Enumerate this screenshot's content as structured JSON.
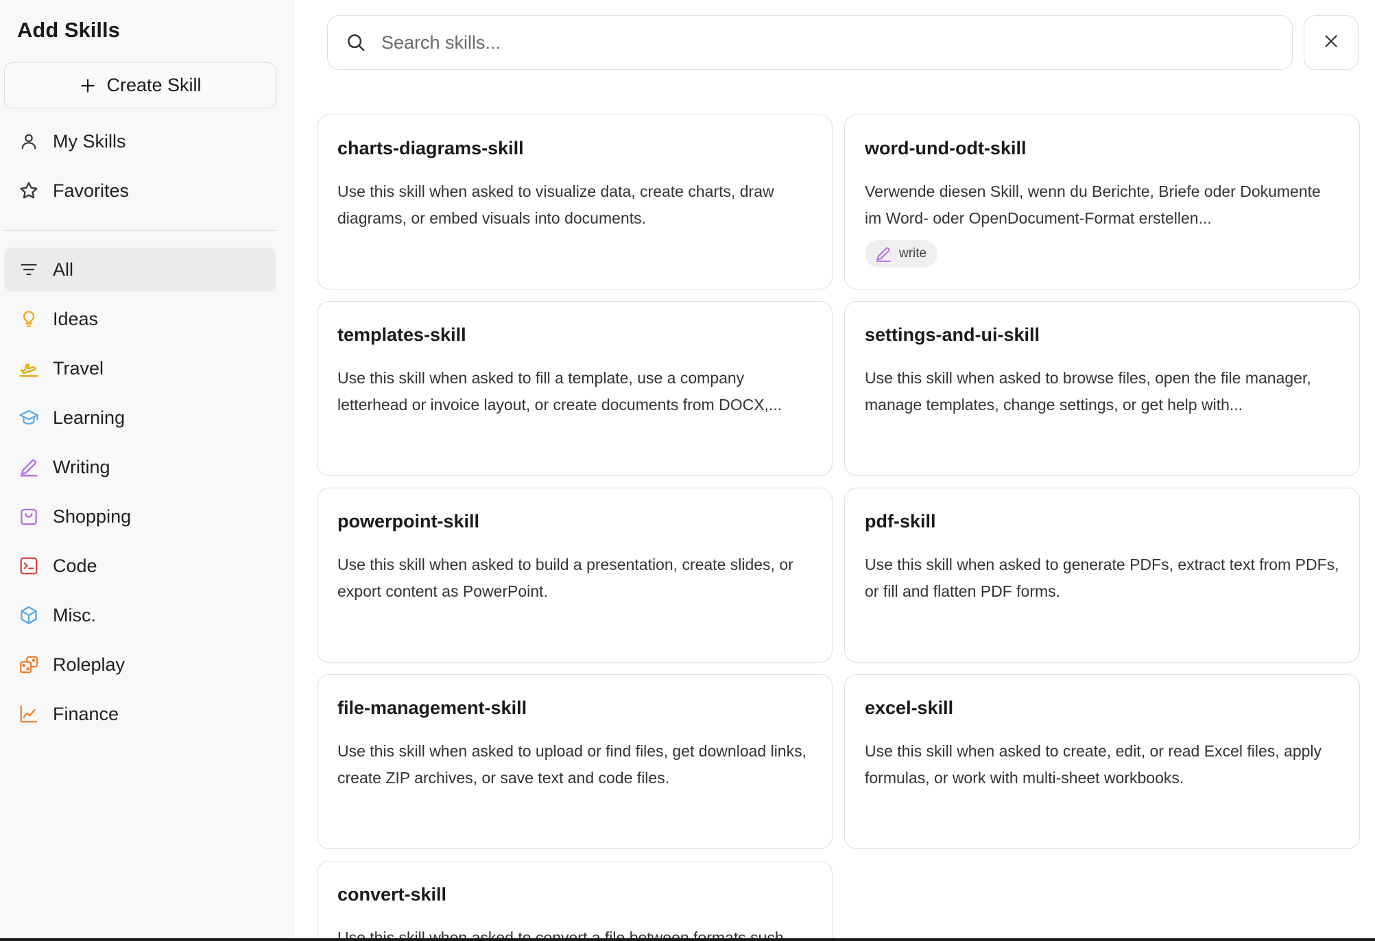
{
  "sidebar": {
    "title": "Add Skills",
    "create_label": "Create Skill",
    "top_items": [
      {
        "label": "My Skills",
        "icon": "user-icon"
      },
      {
        "label": "Favorites",
        "icon": "star-icon"
      }
    ],
    "categories": [
      {
        "label": "All",
        "icon": "filter-icon",
        "color": "#333333",
        "active": true
      },
      {
        "label": "Ideas",
        "icon": "lightbulb-icon",
        "color": "#e8a400"
      },
      {
        "label": "Travel",
        "icon": "plane-icon",
        "color": "#e8a400"
      },
      {
        "label": "Learning",
        "icon": "graduation-cap-icon",
        "color": "#5aa9e6"
      },
      {
        "label": "Writing",
        "icon": "pen-icon",
        "color": "#b36ae2"
      },
      {
        "label": "Shopping",
        "icon": "shopping-bag-icon",
        "color": "#b36ae2"
      },
      {
        "label": "Code",
        "icon": "terminal-icon",
        "color": "#e03e3e"
      },
      {
        "label": "Misc.",
        "icon": "cube-icon",
        "color": "#5aa9e6"
      },
      {
        "label": "Roleplay",
        "icon": "dice-icon",
        "color": "#ef7d2b"
      },
      {
        "label": "Finance",
        "icon": "chart-line-icon",
        "color": "#ef7d2b"
      }
    ]
  },
  "search": {
    "placeholder": "Search skills...",
    "value": ""
  },
  "cards": [
    {
      "title": "charts-diagrams-skill",
      "description": "Use this skill when asked to visualize data, create charts, draw diagrams, or embed visuals into documents."
    },
    {
      "title": "word-und-odt-skill",
      "description": "Verwende diesen Skill, wenn du Berichte, Briefe oder Dokumente im Word- oder OpenDocument-Format erstellen...",
      "tag": {
        "label": "write",
        "icon": "pen-icon",
        "color": "#b36ae2"
      }
    },
    {
      "title": "templates-skill",
      "description": "Use this skill when asked to fill a template, use a company letterhead or invoice layout, or create documents from DOCX,..."
    },
    {
      "title": "settings-and-ui-skill",
      "description": "Use this skill when asked to browse files, open the file manager, manage templates, change settings, or get help with..."
    },
    {
      "title": "powerpoint-skill",
      "description": "Use this skill when asked to build a presentation, create slides, or export content as PowerPoint."
    },
    {
      "title": "pdf-skill",
      "description": "Use this skill when asked to generate PDFs, extract text from PDFs, or fill and flatten PDF forms."
    },
    {
      "title": "file-management-skill",
      "description": "Use this skill when asked to upload or find files, get download links, create ZIP archives, or save text and code files."
    },
    {
      "title": "excel-skill",
      "description": "Use this skill when asked to create, edit, or read Excel files, apply formulas, or work with multi-sheet workbooks."
    },
    {
      "title": "convert-skill",
      "description": "Use this skill when asked to convert a file between formats such..."
    }
  ]
}
